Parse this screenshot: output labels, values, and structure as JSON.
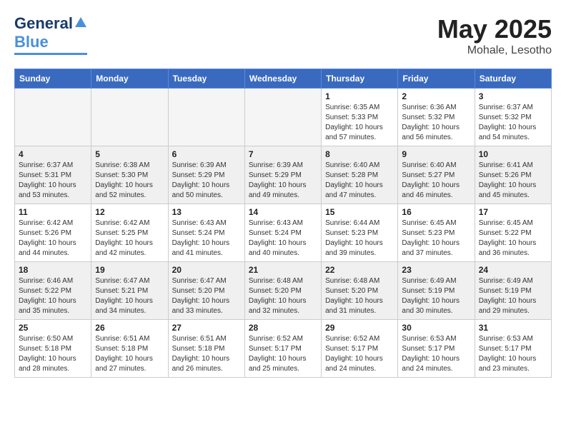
{
  "header": {
    "logo_line1": "General",
    "logo_line2": "Blue",
    "month_year": "May 2025",
    "location": "Mohale, Lesotho"
  },
  "weekdays": [
    "Sunday",
    "Monday",
    "Tuesday",
    "Wednesday",
    "Thursday",
    "Friday",
    "Saturday"
  ],
  "weeks": [
    [
      {
        "day": "",
        "info": "",
        "empty": true
      },
      {
        "day": "",
        "info": "",
        "empty": true
      },
      {
        "day": "",
        "info": "",
        "empty": true
      },
      {
        "day": "",
        "info": "",
        "empty": true
      },
      {
        "day": "1",
        "info": "Sunrise: 6:35 AM\nSunset: 5:33 PM\nDaylight: 10 hours\nand 57 minutes."
      },
      {
        "day": "2",
        "info": "Sunrise: 6:36 AM\nSunset: 5:32 PM\nDaylight: 10 hours\nand 56 minutes."
      },
      {
        "day": "3",
        "info": "Sunrise: 6:37 AM\nSunset: 5:32 PM\nDaylight: 10 hours\nand 54 minutes."
      }
    ],
    [
      {
        "day": "4",
        "info": "Sunrise: 6:37 AM\nSunset: 5:31 PM\nDaylight: 10 hours\nand 53 minutes."
      },
      {
        "day": "5",
        "info": "Sunrise: 6:38 AM\nSunset: 5:30 PM\nDaylight: 10 hours\nand 52 minutes."
      },
      {
        "day": "6",
        "info": "Sunrise: 6:39 AM\nSunset: 5:29 PM\nDaylight: 10 hours\nand 50 minutes."
      },
      {
        "day": "7",
        "info": "Sunrise: 6:39 AM\nSunset: 5:29 PM\nDaylight: 10 hours\nand 49 minutes."
      },
      {
        "day": "8",
        "info": "Sunrise: 6:40 AM\nSunset: 5:28 PM\nDaylight: 10 hours\nand 47 minutes."
      },
      {
        "day": "9",
        "info": "Sunrise: 6:40 AM\nSunset: 5:27 PM\nDaylight: 10 hours\nand 46 minutes."
      },
      {
        "day": "10",
        "info": "Sunrise: 6:41 AM\nSunset: 5:26 PM\nDaylight: 10 hours\nand 45 minutes."
      }
    ],
    [
      {
        "day": "11",
        "info": "Sunrise: 6:42 AM\nSunset: 5:26 PM\nDaylight: 10 hours\nand 44 minutes."
      },
      {
        "day": "12",
        "info": "Sunrise: 6:42 AM\nSunset: 5:25 PM\nDaylight: 10 hours\nand 42 minutes."
      },
      {
        "day": "13",
        "info": "Sunrise: 6:43 AM\nSunset: 5:24 PM\nDaylight: 10 hours\nand 41 minutes."
      },
      {
        "day": "14",
        "info": "Sunrise: 6:43 AM\nSunset: 5:24 PM\nDaylight: 10 hours\nand 40 minutes."
      },
      {
        "day": "15",
        "info": "Sunrise: 6:44 AM\nSunset: 5:23 PM\nDaylight: 10 hours\nand 39 minutes."
      },
      {
        "day": "16",
        "info": "Sunrise: 6:45 AM\nSunset: 5:23 PM\nDaylight: 10 hours\nand 37 minutes."
      },
      {
        "day": "17",
        "info": "Sunrise: 6:45 AM\nSunset: 5:22 PM\nDaylight: 10 hours\nand 36 minutes."
      }
    ],
    [
      {
        "day": "18",
        "info": "Sunrise: 6:46 AM\nSunset: 5:22 PM\nDaylight: 10 hours\nand 35 minutes."
      },
      {
        "day": "19",
        "info": "Sunrise: 6:47 AM\nSunset: 5:21 PM\nDaylight: 10 hours\nand 34 minutes."
      },
      {
        "day": "20",
        "info": "Sunrise: 6:47 AM\nSunset: 5:20 PM\nDaylight: 10 hours\nand 33 minutes."
      },
      {
        "day": "21",
        "info": "Sunrise: 6:48 AM\nSunset: 5:20 PM\nDaylight: 10 hours\nand 32 minutes."
      },
      {
        "day": "22",
        "info": "Sunrise: 6:48 AM\nSunset: 5:20 PM\nDaylight: 10 hours\nand 31 minutes."
      },
      {
        "day": "23",
        "info": "Sunrise: 6:49 AM\nSunset: 5:19 PM\nDaylight: 10 hours\nand 30 minutes."
      },
      {
        "day": "24",
        "info": "Sunrise: 6:49 AM\nSunset: 5:19 PM\nDaylight: 10 hours\nand 29 minutes."
      }
    ],
    [
      {
        "day": "25",
        "info": "Sunrise: 6:50 AM\nSunset: 5:18 PM\nDaylight: 10 hours\nand 28 minutes."
      },
      {
        "day": "26",
        "info": "Sunrise: 6:51 AM\nSunset: 5:18 PM\nDaylight: 10 hours\nand 27 minutes."
      },
      {
        "day": "27",
        "info": "Sunrise: 6:51 AM\nSunset: 5:18 PM\nDaylight: 10 hours\nand 26 minutes."
      },
      {
        "day": "28",
        "info": "Sunrise: 6:52 AM\nSunset: 5:17 PM\nDaylight: 10 hours\nand 25 minutes."
      },
      {
        "day": "29",
        "info": "Sunrise: 6:52 AM\nSunset: 5:17 PM\nDaylight: 10 hours\nand 24 minutes."
      },
      {
        "day": "30",
        "info": "Sunrise: 6:53 AM\nSunset: 5:17 PM\nDaylight: 10 hours\nand 24 minutes."
      },
      {
        "day": "31",
        "info": "Sunrise: 6:53 AM\nSunset: 5:17 PM\nDaylight: 10 hours\nand 23 minutes."
      }
    ]
  ]
}
